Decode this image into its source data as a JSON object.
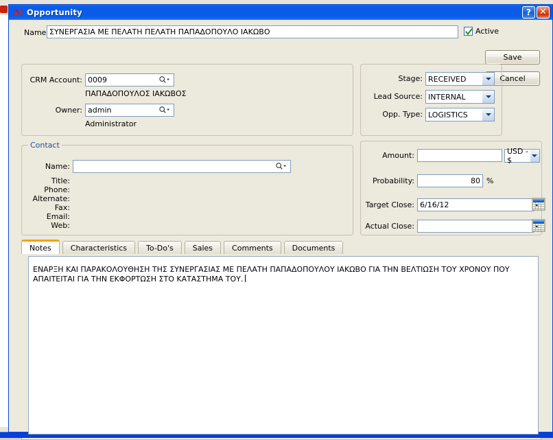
{
  "window": {
    "title": "Opportunity",
    "icon": "app-x-icon",
    "help_button": "?",
    "close_button": "✕",
    "accent_title_bar": "#0a5ce8",
    "form_background": "#ece9dd"
  },
  "header": {
    "name_label": "Name:",
    "name_value": "ΣΥΝΕΡΓΑΣΙΑ ΜΕ ΠΕΛΑΤΗ ΠΕΛΑΤΗ ΠΑΠΑΔΟΠΟΥΛΟ ΙΑΚΩΒΟ",
    "name_placeholder": "",
    "active_label": "Active",
    "active_checked": true,
    "save_label": "Save",
    "cancel_label": "Cancel"
  },
  "crm_group": {
    "account_label": "CRM Account:",
    "account_value": "0009",
    "account_display_name": "ΠΑΠΑΔΟΠΟΥΛΟΣ ΙΑΚΩΒΟΣ",
    "owner_label": "Owner:",
    "owner_value": "admin",
    "owner_display_name": "Administrator",
    "lookup_icon": "magnifier-dropdown-icon"
  },
  "stage_group": {
    "stage_label": "Stage:",
    "stage_value": "RECEIVED",
    "lead_source_label": "Lead Source:",
    "lead_source_value": "INTERNAL",
    "opp_type_label": "Opp. Type:",
    "opp_type_value": "LOGISTICS"
  },
  "contact_group": {
    "legend": "Contact",
    "name_label": "Name:",
    "name_value": "",
    "title_label": "Title:",
    "title_value": "",
    "phone_label": "Phone:",
    "phone_value": "",
    "alternate_label": "Alternate:",
    "alternate_value": "",
    "fax_label": "Fax:",
    "fax_value": "",
    "email_label": "Email:",
    "email_value": "",
    "web_label": "Web:",
    "web_value": ""
  },
  "money_group": {
    "amount_label": "Amount:",
    "amount_value": "",
    "currency_value": "USD - $",
    "probability_label": "Probability:",
    "probability_value": "80",
    "probability_suffix": "%",
    "target_close_label": "Target Close:",
    "target_close_value": "6/16/12",
    "actual_close_label": "Actual Close:",
    "actual_close_value": "",
    "calendar_icon": "calendar-icon"
  },
  "tabs": [
    {
      "label": "Notes",
      "active": true
    },
    {
      "label": "Characteristics",
      "active": false
    },
    {
      "label": "To-Do's",
      "active": false
    },
    {
      "label": "Sales",
      "active": false
    },
    {
      "label": "Comments",
      "active": false
    },
    {
      "label": "Documents",
      "active": false
    }
  ],
  "notes": {
    "text": "ΕΝΑΡΞΗ ΚΑΙ ΠΑΡΑΚΟΛΟΥΘΗΣΗ ΤΗΣ ΣΥΝΕΡΓΑΣΙΑΣ ΜΕ ΠΕΛΑΤΗ ΠΑΠΑΔΟΠΟΥΛΟΥ ΙΑΚΩΒΟ ΓΙΑ ΤΗΝ ΒΕΛΤΙΩΣΗ ΤΟΥ ΧΡΟΝΟΥ ΠΟΥ ΑΠΑΙΤΕΙΤΑΙ ΓΙΑ ΤΗΝ ΕΚΦΟΡΤΩΣΗ ΣΤΟ ΚΑΤΑΣΤΗΜΑ ΤΟΥ."
  }
}
